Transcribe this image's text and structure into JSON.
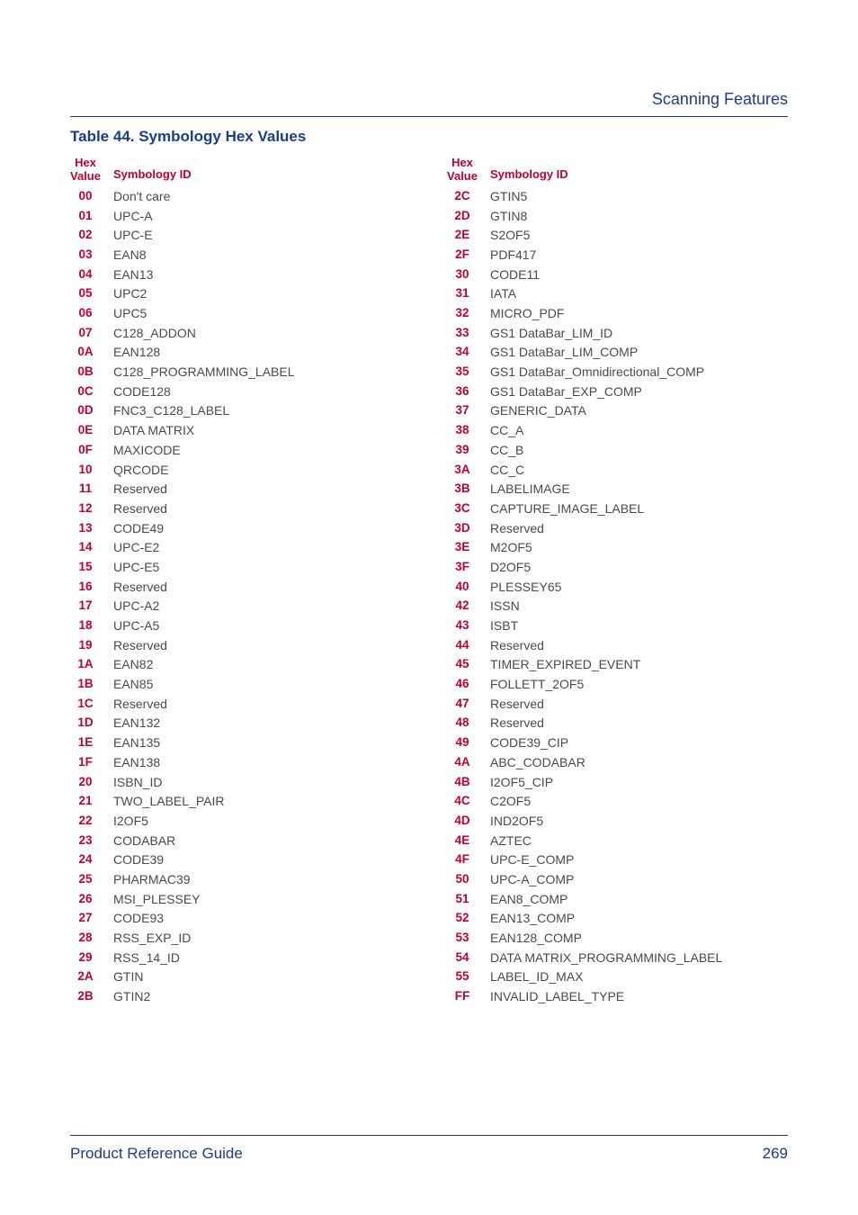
{
  "header": {
    "section": "Scanning Features"
  },
  "table": {
    "title": "Table 44. Symbology Hex Values",
    "hexHeader1": "Hex",
    "hexHeader2": "Value",
    "symHeader": "Symbology ID",
    "left": [
      {
        "hex": "00",
        "sym": "Don't care"
      },
      {
        "hex": "01",
        "sym": "UPC-A"
      },
      {
        "hex": "02",
        "sym": "UPC-E"
      },
      {
        "hex": "03",
        "sym": "EAN8"
      },
      {
        "hex": "04",
        "sym": "EAN13"
      },
      {
        "hex": "05",
        "sym": "UPC2"
      },
      {
        "hex": "06",
        "sym": "UPC5"
      },
      {
        "hex": "07",
        "sym": "C128_ADDON"
      },
      {
        "hex": "0A",
        "sym": "EAN128"
      },
      {
        "hex": "0B",
        "sym": "C128_PROGRAMMING_LABEL"
      },
      {
        "hex": "0C",
        "sym": "CODE128"
      },
      {
        "hex": "0D",
        "sym": "FNC3_C128_LABEL"
      },
      {
        "hex": "0E",
        "sym": "DATA MATRIX"
      },
      {
        "hex": "0F",
        "sym": "MAXICODE"
      },
      {
        "hex": "10",
        "sym": "QRCODE"
      },
      {
        "hex": "11",
        "sym": "Reserved"
      },
      {
        "hex": "12",
        "sym": "Reserved"
      },
      {
        "hex": "13",
        "sym": "CODE49"
      },
      {
        "hex": "14",
        "sym": "UPC-E2"
      },
      {
        "hex": "15",
        "sym": "UPC-E5"
      },
      {
        "hex": "16",
        "sym": "Reserved"
      },
      {
        "hex": "17",
        "sym": "UPC-A2"
      },
      {
        "hex": "18",
        "sym": "UPC-A5"
      },
      {
        "hex": "19",
        "sym": "Reserved"
      },
      {
        "hex": "1A",
        "sym": "EAN82"
      },
      {
        "hex": "1B",
        "sym": "EAN85"
      },
      {
        "hex": "1C",
        "sym": "Reserved"
      },
      {
        "hex": "1D",
        "sym": "EAN132"
      },
      {
        "hex": "1E",
        "sym": "EAN135"
      },
      {
        "hex": "1F",
        "sym": "EAN138"
      },
      {
        "hex": "20",
        "sym": "ISBN_ID"
      },
      {
        "hex": "21",
        "sym": "TWO_LABEL_PAIR"
      },
      {
        "hex": "22",
        "sym": "I2OF5"
      },
      {
        "hex": "23",
        "sym": "CODABAR"
      },
      {
        "hex": "24",
        "sym": "CODE39"
      },
      {
        "hex": "25",
        "sym": "PHARMAC39"
      },
      {
        "hex": "26",
        "sym": "MSI_PLESSEY"
      },
      {
        "hex": "27",
        "sym": "CODE93"
      },
      {
        "hex": "28",
        "sym": "RSS_EXP_ID"
      },
      {
        "hex": "29",
        "sym": "RSS_14_ID"
      },
      {
        "hex": "2A",
        "sym": "GTIN"
      },
      {
        "hex": "2B",
        "sym": "GTIN2"
      }
    ],
    "right": [
      {
        "hex": "2C",
        "sym": "GTIN5"
      },
      {
        "hex": "2D",
        "sym": "GTIN8"
      },
      {
        "hex": "2E",
        "sym": "S2OF5"
      },
      {
        "hex": "2F",
        "sym": "PDF417"
      },
      {
        "hex": "30",
        "sym": "CODE11"
      },
      {
        "hex": "31",
        "sym": "IATA"
      },
      {
        "hex": "32",
        "sym": "MICRO_PDF"
      },
      {
        "hex": "33",
        "sym": "GS1 DataBar_LIM_ID"
      },
      {
        "hex": "34",
        "sym": "GS1 DataBar_LIM_COMP"
      },
      {
        "hex": "35",
        "sym": "GS1 DataBar_Omnidirectional_COMP"
      },
      {
        "hex": "36",
        "sym": "GS1 DataBar_EXP_COMP"
      },
      {
        "hex": "37",
        "sym": "GENERIC_DATA"
      },
      {
        "hex": "38",
        "sym": "CC_A"
      },
      {
        "hex": "39",
        "sym": "CC_B"
      },
      {
        "hex": "3A",
        "sym": "CC_C"
      },
      {
        "hex": "3B",
        "sym": "LABELIMAGE"
      },
      {
        "hex": "3C",
        "sym": "CAPTURE_IMAGE_LABEL"
      },
      {
        "hex": "3D",
        "sym": "Reserved"
      },
      {
        "hex": "3E",
        "sym": "M2OF5"
      },
      {
        "hex": "3F",
        "sym": "D2OF5"
      },
      {
        "hex": "40",
        "sym": "PLESSEY65"
      },
      {
        "hex": "42",
        "sym": "ISSN"
      },
      {
        "hex": "43",
        "sym": "ISBT"
      },
      {
        "hex": "44",
        "sym": "Reserved"
      },
      {
        "hex": "45",
        "sym": "TIMER_EXPIRED_EVENT"
      },
      {
        "hex": "46",
        "sym": "FOLLETT_2OF5"
      },
      {
        "hex": "47",
        "sym": "Reserved"
      },
      {
        "hex": "48",
        "sym": "Reserved"
      },
      {
        "hex": "49",
        "sym": "CODE39_CIP"
      },
      {
        "hex": "4A",
        "sym": "ABC_CODABAR"
      },
      {
        "hex": "4B",
        "sym": "I2OF5_CIP"
      },
      {
        "hex": "4C",
        "sym": "C2OF5"
      },
      {
        "hex": "4D",
        "sym": "IND2OF5"
      },
      {
        "hex": "4E",
        "sym": "AZTEC"
      },
      {
        "hex": "4F",
        "sym": "UPC-E_COMP"
      },
      {
        "hex": "50",
        "sym": "UPC-A_COMP"
      },
      {
        "hex": "51",
        "sym": "EAN8_COMP"
      },
      {
        "hex": "52",
        "sym": "EAN13_COMP"
      },
      {
        "hex": "53",
        "sym": "EAN128_COMP"
      },
      {
        "hex": "54",
        "sym": "DATA MATRIX_PROGRAMMING_LABEL"
      },
      {
        "hex": "55",
        "sym": "LABEL_ID_MAX"
      },
      {
        "hex": "FF",
        "sym": "INVALID_LABEL_TYPE"
      }
    ]
  },
  "footer": {
    "left": "Product Reference Guide",
    "right": "269"
  }
}
